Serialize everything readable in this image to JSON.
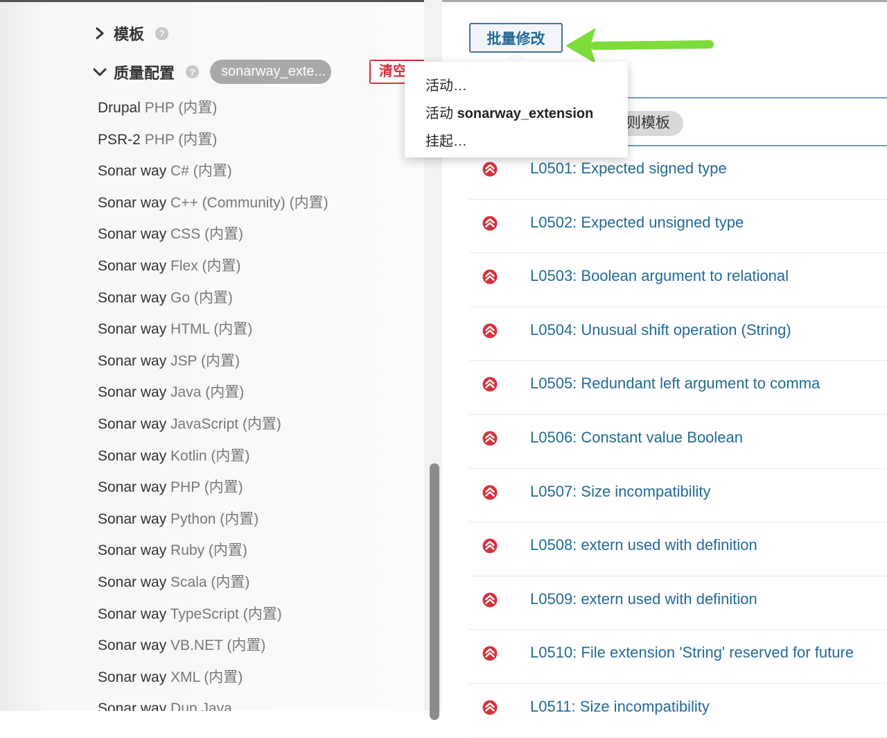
{
  "sidebar": {
    "template_section": {
      "label": "模板",
      "help": "?"
    },
    "quality_section": {
      "label": "质量配置",
      "help": "?",
      "selected_profile": "sonarway_exte...",
      "clear_label": "清空"
    },
    "profiles": [
      {
        "prefix": "Drupal",
        "name": " PHP (内置)"
      },
      {
        "prefix": "PSR-2",
        "name": " PHP (内置)"
      },
      {
        "prefix": "Sonar way",
        "name": " C# (内置)"
      },
      {
        "prefix": "Sonar way",
        "name": " C++ (Community) (内置)"
      },
      {
        "prefix": "Sonar way",
        "name": " CSS (内置)"
      },
      {
        "prefix": "Sonar way",
        "name": " Flex (内置)"
      },
      {
        "prefix": "Sonar way",
        "name": " Go (内置)"
      },
      {
        "prefix": "Sonar way",
        "name": " HTML (内置)"
      },
      {
        "prefix": "Sonar way",
        "name": " JSP (内置)"
      },
      {
        "prefix": "Sonar way",
        "name": " Java (内置)"
      },
      {
        "prefix": "Sonar way",
        "name": " JavaScript (内置)"
      },
      {
        "prefix": "Sonar way",
        "name": " Kotlin (内置)"
      },
      {
        "prefix": "Sonar way",
        "name": " PHP (内置)"
      },
      {
        "prefix": "Sonar way",
        "name": " Python (内置)"
      },
      {
        "prefix": "Sonar way",
        "name": " Ruby (内置)"
      },
      {
        "prefix": "Sonar way",
        "name": " Scala (内置)"
      },
      {
        "prefix": "Sonar way",
        "name": " TypeScript (内置)"
      },
      {
        "prefix": "Sonar way",
        "name": " VB.NET (内置)"
      },
      {
        "prefix": "Sonar way",
        "name": " XML (内置)"
      },
      {
        "prefix": "Sonar way",
        "name": " Dup Java"
      }
    ]
  },
  "main": {
    "bulk_change_label": "批量修改",
    "rule_template_chip": "则模板",
    "rules": [
      "L0501: Expected signed type",
      "L0502: Expected unsigned type",
      "L0503: Boolean argument to relational",
      "L0504: Unusual shift operation (String)",
      "L0505: Redundant left argument to comma",
      "L0506: Constant value Boolean",
      "L0507: Size incompatibility",
      "L0508: extern used with definition",
      "L0509: extern used with definition",
      "L0510: File extension 'String' reserved for future",
      "L0511: Size incompatibility"
    ]
  },
  "dropdown": {
    "items": [
      {
        "label": "活动…",
        "bold": ""
      },
      {
        "label": "活动 ",
        "bold": "sonarway_extension"
      },
      {
        "label": "挂起…",
        "bold": ""
      }
    ]
  },
  "colors": {
    "link": "#236a97",
    "severity": "#d4333f",
    "annotation_arrow": "#7ddc3a"
  },
  "icons": {
    "expand": "chevron-right-icon",
    "collapse": "chevron-down-icon",
    "help": "question-circle-icon",
    "severity": "major-severity-icon"
  }
}
